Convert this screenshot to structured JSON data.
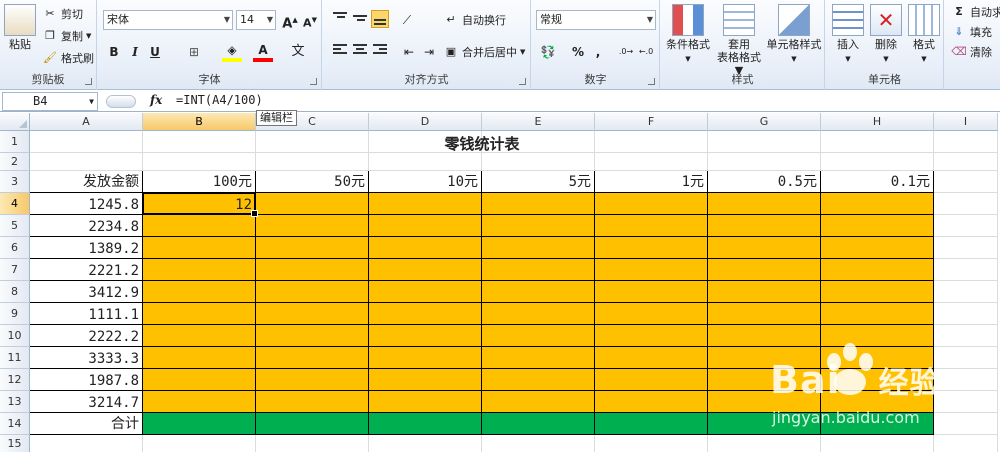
{
  "ribbon": {
    "clipboard": {
      "paste": "粘贴",
      "cut": "剪切",
      "copy": "复制",
      "format_painter": "格式刷",
      "label": "剪贴板"
    },
    "font": {
      "name": "宋体",
      "size": "14",
      "bold": "B",
      "italic": "I",
      "underline": "U",
      "label": "字体"
    },
    "alignment": {
      "wrap": "自动换行",
      "merge": "合并后居中",
      "label": "对齐方式"
    },
    "number": {
      "format": "常规",
      "percent": "%",
      "comma": ",",
      "label": "数字"
    },
    "styles": {
      "conditional": "条件格式",
      "table_format_1": "套用",
      "table_format_2": "表格格式",
      "cell_styles": "单元格样式",
      "label": "样式"
    },
    "cells": {
      "insert": "插入",
      "delete": "删除",
      "format": "格式",
      "label": "单元格"
    },
    "editing": {
      "autosum": "自动求",
      "fill": "填充",
      "clear": "清除"
    }
  },
  "formula_bar": {
    "name_box": "B4",
    "fx": "fx",
    "formula": "=INT(A4/100)",
    "tooltip": "编辑栏"
  },
  "columns": [
    "A",
    "B",
    "C",
    "D",
    "E",
    "F",
    "G",
    "H",
    "I"
  ],
  "rows": [
    "1",
    "2",
    "3",
    "4",
    "5",
    "6",
    "7",
    "8",
    "9",
    "10",
    "11",
    "12",
    "13",
    "14",
    "15"
  ],
  "sheet": {
    "title": "零钱统计表",
    "header_a": "发放金额",
    "denominations": [
      "100元",
      "50元",
      "10元",
      "5元",
      "1元",
      "0.5元",
      "0.1元"
    ],
    "amounts": [
      "1245.8",
      "2234.8",
      "1389.2",
      "2221.2",
      "3412.9",
      "1111.1",
      "2222.2",
      "3333.3",
      "1987.8",
      "3214.7"
    ],
    "b4_value": "12",
    "total_label": "合计"
  },
  "colors": {
    "fill_orange": "#ffc000",
    "fill_green": "#00b050",
    "selection": "#f8c86a"
  },
  "watermark": {
    "brand": "Bai",
    "brand_cn": "经验",
    "site": "jingyan.baidu.com"
  }
}
